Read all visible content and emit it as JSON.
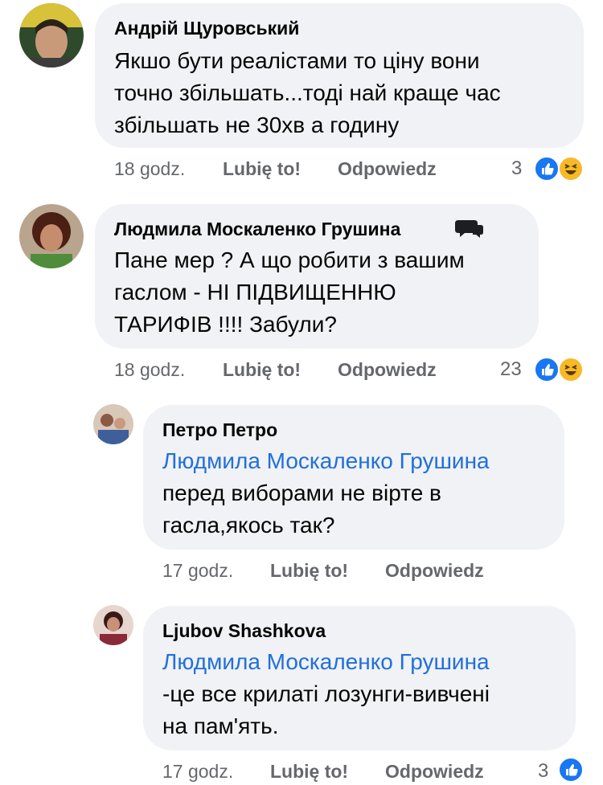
{
  "comments": [
    {
      "author": "Андрій Щуровський",
      "lines": [
        "Якшо бути реалістами то ціну вони",
        "точно збільшать...тоді най краще час",
        "збільшать не 30хв а годину"
      ],
      "time": "18 godz.",
      "like_label": "Lubię to!",
      "reply_label": "Odpowiedz",
      "reaction_count": "3",
      "reactions": [
        "like-icon",
        "haha-icon"
      ]
    },
    {
      "author": "Людмила Москаленко Грушина",
      "badge": "conversation-starter-icon",
      "lines": [
        "Пане мер ? А що робити з вашим",
        "гаслом - НІ ПІДВИЩЕННЮ",
        "ТАРИФІВ !!!! Забули?"
      ],
      "time": "18 godz.",
      "like_label": "Lubię to!",
      "reply_label": "Odpowiedz",
      "reaction_count": "23",
      "reactions": [
        "like-icon",
        "haha-icon"
      ]
    },
    {
      "author": "Петро Петро",
      "mention": "Людмила Москаленко Грушина",
      "lines": [
        "перед виборами не вірте в",
        "гасла,якось так?"
      ],
      "time": "17 godz.",
      "like_label": "Lubię to!",
      "reply_label": "Odpowiedz"
    },
    {
      "author": "Ljubov Shashkova",
      "mention": "Людмила Москаленко Грушина",
      "lines": [
        "-це все крилаті лозунги-вивчені",
        "на пам'ять."
      ],
      "time": "17 godz.",
      "like_label": "Lubię to!",
      "reply_label": "Odpowiedz",
      "reaction_count": "3",
      "reactions": [
        "like-icon"
      ]
    }
  ],
  "colors": {
    "bubble": "#f0f2f5",
    "mention": "#216fdb",
    "meta": "#65676b",
    "like": "#1877f2",
    "haha": "#f7b928"
  }
}
